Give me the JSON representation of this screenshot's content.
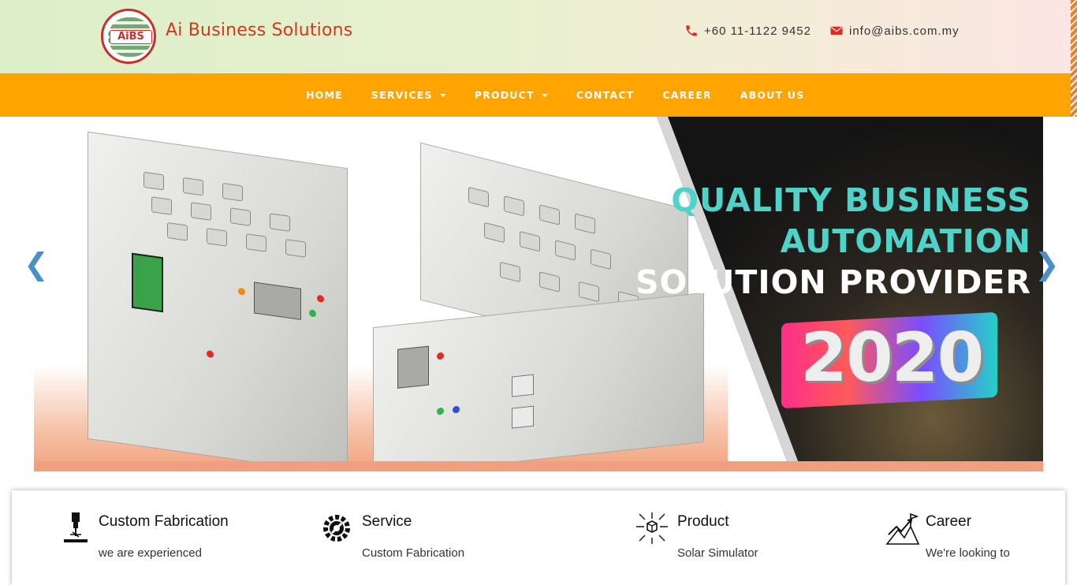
{
  "header": {
    "logo_text": "AiBS",
    "brand_name": "Ai Business Solutions",
    "phone": "+60 11-1122 9452",
    "email": "info@aibs.com.my"
  },
  "nav": {
    "items": [
      {
        "label": "HOME",
        "dropdown": false
      },
      {
        "label": "SERVICES",
        "dropdown": true
      },
      {
        "label": "PRODUCT",
        "dropdown": true
      },
      {
        "label": "CONTACT",
        "dropdown": false
      },
      {
        "label": "CAREER",
        "dropdown": false
      },
      {
        "label": "ABOUT US",
        "dropdown": false
      }
    ]
  },
  "hero": {
    "line1": "QUALITY BUSINESS",
    "line2": "AUTOMATION",
    "line3": "SOLUTION PROVIDER",
    "year": "2020",
    "prev_icon": "chevron-left-icon",
    "next_icon": "chevron-right-icon"
  },
  "features": [
    {
      "title": "Custom Fabrication",
      "desc": "we are experienced",
      "icon": "laser-cutter-icon"
    },
    {
      "title": "Service",
      "desc": "Custom Fabrication",
      "icon": "gear-wrench-icon"
    },
    {
      "title": "Product",
      "desc": "Solar Simulator",
      "icon": "box-network-icon"
    },
    {
      "title": "Career",
      "desc": "We're looking to",
      "icon": "growth-chart-icon"
    }
  ],
  "colors": {
    "nav_bg": "#ffa400",
    "brand_red": "#d03a1c",
    "hero_teal": "#4fd3c9",
    "icon_red": "#e02b20"
  }
}
